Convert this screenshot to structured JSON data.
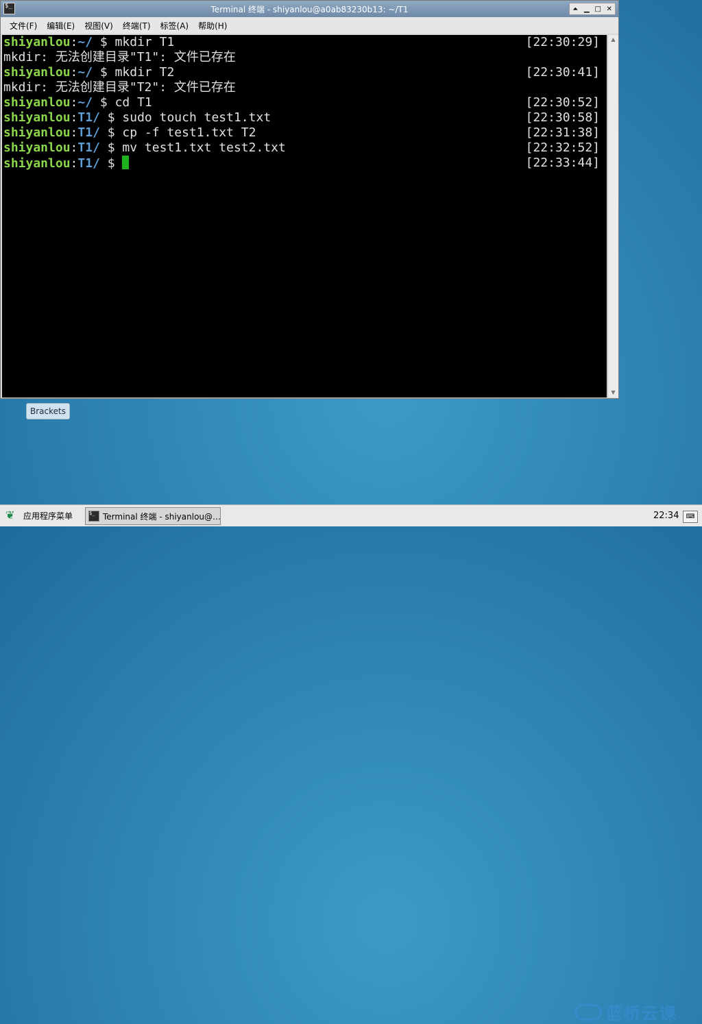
{
  "window": {
    "title": "Terminal 终端 - shiyanlou@a0ab83230b13: ~/T1",
    "icon": "terminal-icon",
    "controls": {
      "shade": "⏶",
      "minimize": "▁",
      "maximize": "□",
      "close": "✕"
    }
  },
  "menu": [
    "文件(F)",
    "编辑(E)",
    "视图(V)",
    "终端(T)",
    "标签(A)",
    "帮助(H)"
  ],
  "terminal": {
    "lines": [
      {
        "type": "prompt",
        "user": "shiyanlou",
        "path": "~/",
        "cmd": " $ mkdir T1",
        "ts": "[22:30:29]"
      },
      {
        "type": "output",
        "text": "mkdir: 无法创建目录\"T1\": 文件已存在"
      },
      {
        "type": "prompt",
        "user": "shiyanlou",
        "path": "~/",
        "cmd": " $ mkdir T2",
        "ts": "[22:30:41]"
      },
      {
        "type": "output",
        "text": "mkdir: 无法创建目录\"T2\": 文件已存在"
      },
      {
        "type": "prompt",
        "user": "shiyanlou",
        "path": "~/",
        "cmd": " $ cd T1",
        "ts": "[22:30:52]"
      },
      {
        "type": "prompt",
        "user": "shiyanlou",
        "path": "T1/",
        "cmd": " $ sudo touch test1.txt",
        "ts": "[22:30:58]"
      },
      {
        "type": "prompt",
        "user": "shiyanlou",
        "path": "T1/",
        "cmd": " $ cp -f test1.txt T2",
        "ts": "[22:31:38]"
      },
      {
        "type": "prompt",
        "user": "shiyanlou",
        "path": "T1/",
        "cmd": " $ mv test1.txt test2.txt",
        "ts": "[22:32:52]"
      },
      {
        "type": "prompt",
        "user": "shiyanlou",
        "path": "T1/",
        "cmd": " $ ",
        "ts": "[22:33:44]",
        "cursor": true
      }
    ],
    "colors": {
      "background": "#000000",
      "user": "#8bd54b",
      "path": "#5f9fd6",
      "text": "#e0e0e0",
      "cursor": "#1fb21f"
    }
  },
  "desktop": {
    "icon_label": "Brackets"
  },
  "taskbar": {
    "start_label": "应用程序菜单",
    "task_label": "Terminal 终端 - shiyanlou@…",
    "clock": "22:34",
    "watermark": "蓝桥云课"
  }
}
